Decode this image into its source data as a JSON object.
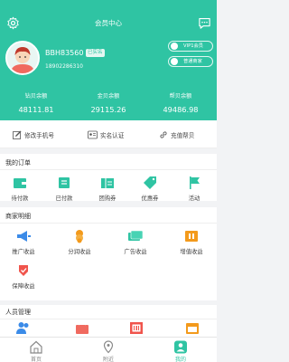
{
  "header": {
    "title": "会员中心"
  },
  "profile": {
    "username": "BBH83560",
    "auth_badge": "已实名",
    "phone": "18902286310",
    "vip_pill": "VIP1会员",
    "normal_pill": "普通商家"
  },
  "balances": [
    {
      "label": "钻贝余额",
      "value": "48111.81"
    },
    {
      "label": "金贝余额",
      "value": "29115.26"
    },
    {
      "label": "帮贝余额",
      "value": "49486.98"
    }
  ],
  "actions": [
    {
      "label": "修改手机号"
    },
    {
      "label": "实名认证"
    },
    {
      "label": "充值帮贝"
    }
  ],
  "orders": {
    "title": "我的订单",
    "items": [
      {
        "label": "待付款"
      },
      {
        "label": "已付款"
      },
      {
        "label": "团购券"
      },
      {
        "label": "优惠券"
      },
      {
        "label": "活动"
      }
    ]
  },
  "merchant": {
    "title": "商家明细",
    "items": [
      {
        "label": "推广收益"
      },
      {
        "label": "分润收益"
      },
      {
        "label": "广告收益"
      },
      {
        "label": "增值收益"
      },
      {
        "label": "保障收益"
      }
    ]
  },
  "personnel": {
    "title": "人员管理"
  },
  "tabs": [
    {
      "label": "首页"
    },
    {
      "label": "附近"
    },
    {
      "label": "我的"
    }
  ],
  "colors": {
    "accent": "#2fc4a3",
    "orange": "#f39a1c",
    "red": "#f0544c"
  }
}
